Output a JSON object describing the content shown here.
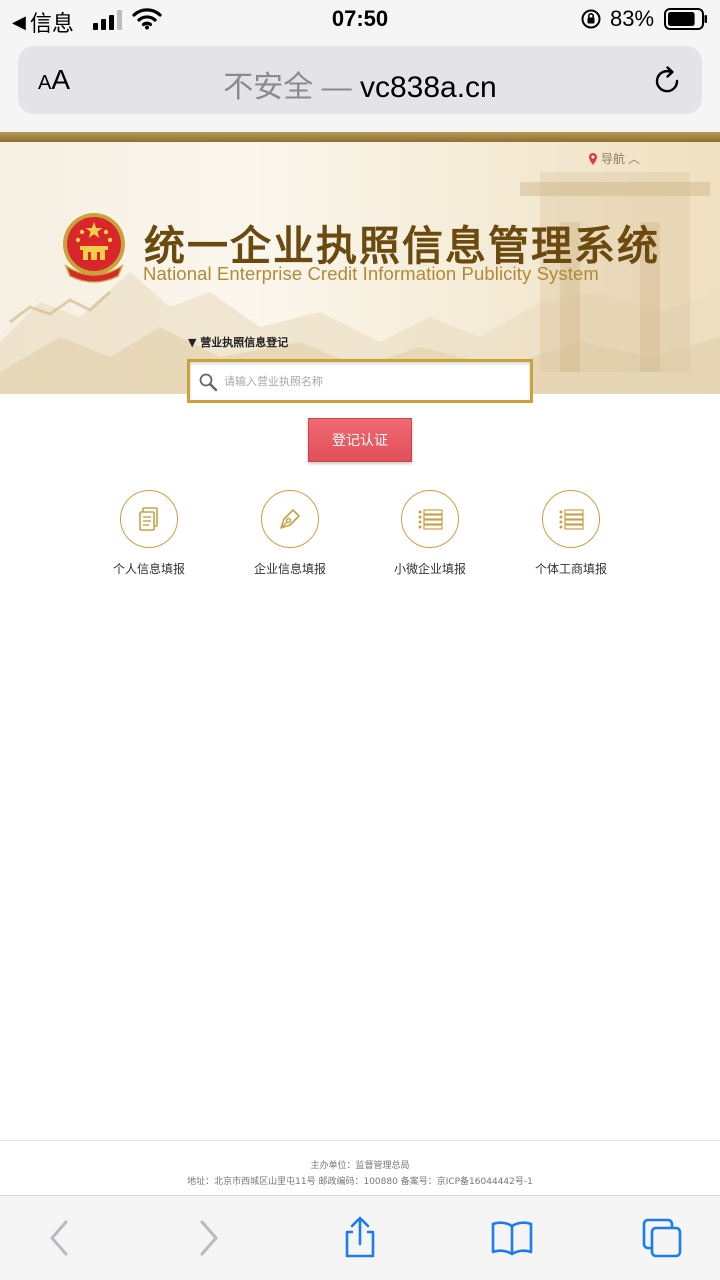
{
  "status_bar": {
    "back_label": "信息",
    "time": "07:50",
    "battery_pct": "83%",
    "battery_level": 0.83
  },
  "browser": {
    "aa_label_small": "A",
    "aa_label_large": "A",
    "url_insecure": "不安全 —",
    "url_domain": " vc838a.cn"
  },
  "header": {
    "nav_label": "导航",
    "title_cn": "统一企业执照信息管理系统",
    "title_en": "National Enterprise Credit Information Publicity System",
    "section_label": "▼  营业执照信息登记"
  },
  "search": {
    "placeholder": "请输入营业执照名称"
  },
  "submit": {
    "label": "登记认证"
  },
  "features": [
    {
      "label": "个人信息填报",
      "icon": "document-icon"
    },
    {
      "label": "企业信息填报",
      "icon": "pen-icon"
    },
    {
      "label": "小微企业填报",
      "icon": "list-icon"
    },
    {
      "label": "个体工商填报",
      "icon": "list-icon"
    }
  ],
  "footer": {
    "line1": "主办单位：监督管理总局",
    "line2": "地址：北京市西城区山里屯11号    邮政编码：100880    备案号：京ICP备16044442号-1"
  },
  "colors": {
    "gold": "#c9a23c",
    "title_brown": "#6b4a10",
    "button_red": "#e24f59",
    "safari_blue": "#1a7cf0"
  }
}
